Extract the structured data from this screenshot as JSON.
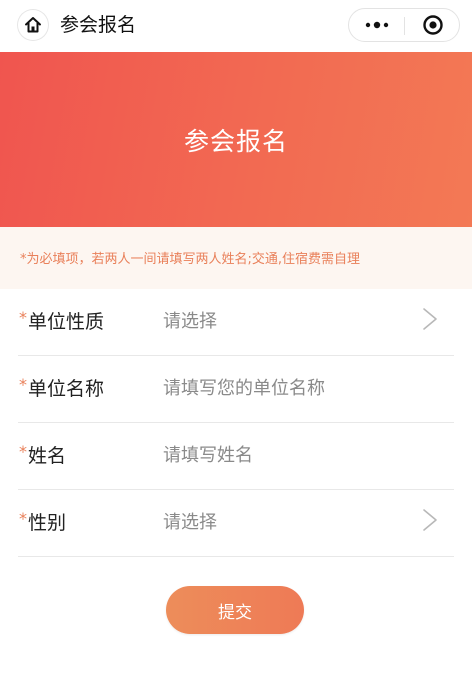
{
  "nav": {
    "title": "参会报名",
    "home_icon": "home-icon",
    "more_icon": "more-dots-icon",
    "close_icon": "target-close-icon"
  },
  "banner": {
    "title": "参会报名",
    "color_start": "#f0554f",
    "color_end": "#f37955"
  },
  "notice": {
    "text": "*为必填项，若两人一间请填写两人姓名;交通,住宿费需自理",
    "color": "#e9805a"
  },
  "form": {
    "fields": [
      {
        "required_mark": "*",
        "label": "单位性质",
        "placeholder": "请选择",
        "type": "select"
      },
      {
        "required_mark": "*",
        "label": "单位名称",
        "placeholder": "请填写您的单位名称",
        "type": "text"
      },
      {
        "required_mark": "*",
        "label": "姓名",
        "placeholder": "请填写姓名",
        "type": "text"
      },
      {
        "required_mark": "*",
        "label": "性别",
        "placeholder": "请选择",
        "type": "select"
      }
    ]
  },
  "submit": {
    "label": "提交",
    "color": "#ee7a56"
  }
}
